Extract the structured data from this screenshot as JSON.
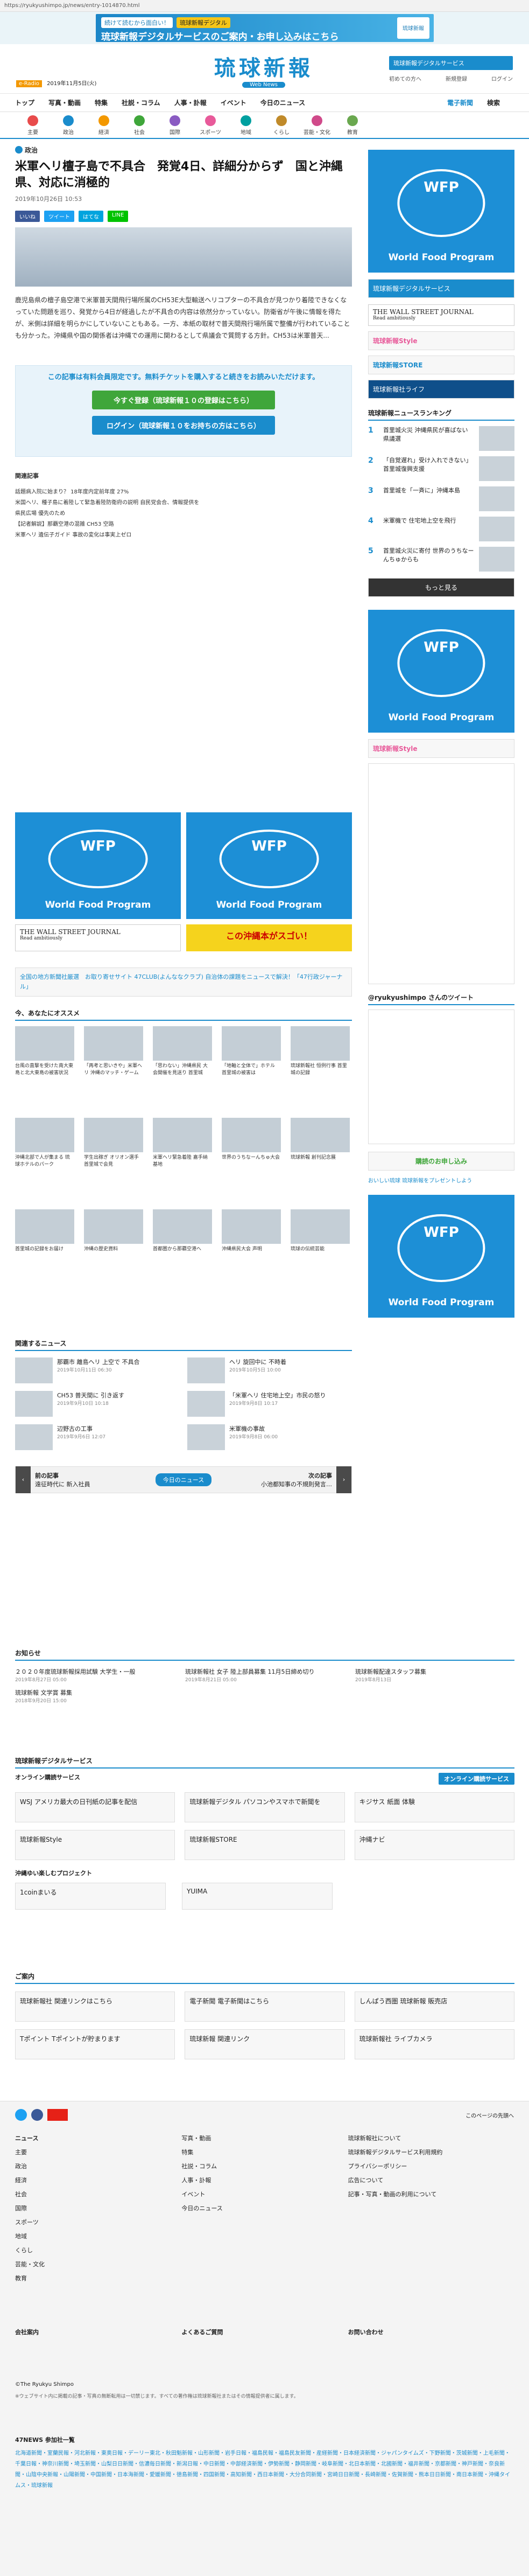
{
  "url": "https://ryukyushimpo.jp/news/entry-1014870.html",
  "top_banner": {
    "tag1": "続けて読むから面白い！",
    "tag2": "琉球新報デジタル",
    "headline": "琉球新報デジタルサービスのご案内・お申し込みはこちら",
    "badge": "琉球新報"
  },
  "header": {
    "logo": "琉球新報",
    "logo_sub": "Web News",
    "tag": "e-Radio",
    "date": "2019年11月5日(火)",
    "digital": "琉球新報デジタルサービス",
    "links": [
      "初めての方へ",
      "新規登録",
      "ログイン"
    ]
  },
  "gnav": [
    "トップ",
    "写真・動画",
    "特集",
    "社説・コラム",
    "人事・訃報",
    "イベント",
    "今日のニュース"
  ],
  "gnav_right": [
    "電子新聞",
    "検索"
  ],
  "cnav": [
    {
      "label": "主要",
      "color": "#e84b4b"
    },
    {
      "label": "政治",
      "color": "#1a8ccc"
    },
    {
      "label": "経済",
      "color": "#f39800"
    },
    {
      "label": "社会",
      "color": "#3fa63a"
    },
    {
      "label": "国際",
      "color": "#8a5bc2"
    },
    {
      "label": "スポーツ",
      "color": "#e85a9a"
    },
    {
      "label": "地域",
      "color": "#00a0a0"
    },
    {
      "label": "くらし",
      "color": "#c08a2a"
    },
    {
      "label": "芸能・文化",
      "color": "#d04a8a"
    },
    {
      "label": "教育",
      "color": "#6aa84f"
    }
  ],
  "article": {
    "category": "政治",
    "title": "米軍ヘリ檀子島で不具合　発覚4日、詳細分からず　国と沖縄県、対応に消極的",
    "date": "2019年10月26日 10:53",
    "share": [
      "いいね",
      "ツイート",
      "はてな",
      "LINE"
    ],
    "lead": "鹿児島県の檀子島空港で米軍普天間飛行場所属のCH53E大型輸送ヘリコプターの不具合が見つかり着陸できなくなっていた問題を巡り、発覚から4日が経過したが不具合の内容は依然分かっていない。防衛省が午後に情報を得たが、米側は詳細を明らかにしていないこともある。一方、本紙の取材で普天間飛行場所属で整備が行われていることも分かった。沖縄県や国の関係者は沖縄での運用に関わるとして県議会で質問する方針。CH53は米軍普天..."
  },
  "paywall": {
    "msg": "この記事は有料会員限定です。無料チケットを購入すると続きをお読みいただけます。",
    "btn1": "今すぐ登録（琉球新報１０の登録はこちら）",
    "btn2": "ログイン（琉球新報１０をお持ちの方はこちら）"
  },
  "related": {
    "heading": "関連記事",
    "items": [
      "話題病入院に始まり？ 18年度内定前年度 27%",
      "米国ヘリ、種子島に着陸して緊急着陸防衛府の説明 自民党会合、情報提供を",
      "県民広場 優先のため",
      "【記者解説】那覇空港の混雑 CH53 空路",
      "米軍ヘリ 遺伝子ガイド 事故の変化は事実上ゼロ"
    ]
  },
  "wfp": {
    "line1": "WFP",
    "line2": "World Food Program"
  },
  "wsj": {
    "title": "THE WALL STREET JOURNAL",
    "sub": "Read ambitiously"
  },
  "okinawa": "この沖縄本がスゴい！",
  "campaign": "全国の地方新聞社厳選　お取り寄せサイト 47CLUB(よんななクラブ) 自治体の課題をニュースで解決！「47行政ジャーナル」",
  "recommend": {
    "heading": "今、あなたにオススメ",
    "cards": [
      "台風の直撃を受けた南大東島と北大東島の被害状況",
      "「再考と思いきや」米軍へリ 沖縄のマッチ・ゲーム",
      "「思わない」沖縄県民 大会開催を見送り 首里城",
      "「地軸と全体で」ホテル 首里城の被害は",
      "琉球新報社 恒例行事 首里城の記録",
      "沖縄北部で人が集まる 琉球ホテルのパーク",
      "学生出稼ぎ オリオン選手 首里城で会見",
      "米軍ヘリ緊急着陸 嘉手納基地",
      "世界のうちなーんちゅ大会",
      "琉球新報 創刊記念展",
      "首里城の記録をお届け",
      "沖縄の歴史資料",
      "首都圏から那覇空港へ",
      "沖縄県民大会 声明",
      "琉球の伝統芸能"
    ]
  },
  "news_list": {
    "heading": "関連するニュース",
    "items": [
      "那覇市 離島ヘリ 上空で 不具合",
      "ヘリ 旋回中に 不時着",
      "CH53 普天間に 引き返す",
      "「米軍ヘリ 住宅地上空」市民の怒り",
      "辺野古の工事",
      "米軍機の事故"
    ],
    "dates": [
      "2019年10月11日 06:30",
      "2019年10月5日 10:00",
      "2019年9月10日 10:18",
      "2019年9月8日 10:17",
      "2019年9月6日 12:07",
      "2019年9月8日 06:00"
    ]
  },
  "pager": {
    "prev": "前の記事",
    "prev_title": "遠征時代に 新入社員",
    "today": "今日のニュース",
    "next": "次の記事",
    "next_title": "小池都知事の不規則発言…"
  },
  "sidebar": {
    "ranking": "琉球新報ニュースランキング",
    "ranks": [
      "首里城火災 沖縄県民が喜ばない 県議選",
      "「自覚遅れ」受け入れできない」 首里城復興支援",
      "首里城を「一斉に」沖縄本島",
      "米軍機で 住宅地上空を飛行",
      "首里城火災に寄付 世界のうちなーんちゅからも"
    ],
    "more": "もっと見る",
    "twitter": "@ryukyushimpo さんのツイート",
    "apply": "購読のお申し込み",
    "gift": "おいしい琉球 琉球新報をプレゼントしよう",
    "store": "琉球新報STORE",
    "life": "琉球新報社ライフ"
  },
  "notice": {
    "heading": "お知らせ",
    "items": [
      "２０２０年度琉球新報採用試験 大学生・一般",
      "琉球新報社 女子 陸上部員募集 11月5日締め切り",
      "琉球新報配達スタッフ募集",
      "琉球新報 文学賞 募集",
      "琉球新報 記事の使用について"
    ],
    "dates": [
      "2019年8月27日 05:00",
      "2019年8月21日 05:00",
      "2019年8月13日",
      "2018年9月20日 15:00"
    ]
  },
  "digital": {
    "heading": "琉球新報デジタルサービス",
    "online": "オンライン購読サービス",
    "items": [
      "WSJ アメリカ最大の日刊紙の記事を配信",
      "琉球新報デジタル パソコンやスマホで新聞を",
      "キジサス 紙面 体験",
      "琉球新報Style",
      "琉球新報STORE",
      "沖縄ナビ"
    ],
    "okinawa_sub": "沖縄ゆい楽しむプロジェクト",
    "yuima": [
      "1coinまいる",
      "YUIMA"
    ]
  },
  "guide": {
    "heading": "ご案内",
    "items": [
      "琉球新報社 関連リンクはこちら",
      "電子新聞 電子新聞はこちら",
      "しんぱう西圏 琉球新報 販売店",
      "Tポイント Tポイントが貯まります",
      "琉球新報 関連リンク",
      "琉球新報社 ライブカメラ"
    ]
  },
  "footer": {
    "cols": [
      [
        "ニュース",
        "主要",
        "政治",
        "経済",
        "社会",
        "国際",
        "スポーツ",
        "地域",
        "くらし",
        "芸能・文化",
        "教育"
      ],
      [
        "写真・動画",
        "特集",
        "社説・コラム",
        "人事・訃報",
        "イベント",
        "今日のニュース"
      ],
      [
        "琉球新報社について",
        "琉球新報デジタルサービス利用規約",
        "プライバシーポリシー",
        "広告について",
        "記事・写真・動画の利用について"
      ]
    ],
    "company": [
      "会社案内",
      "よくあるご質問",
      "お問い合わせ"
    ],
    "copyright": "©The Ryukyu Shimpo",
    "note": "※ウェブサイト内に掲載の記事・写真の無断転用は一切禁じます。すべての著作権は琉球新報社またはその情報提供者に属します。",
    "prev": "このページの先頭へ",
    "partners_h": "47NEWS 参加社一覧",
    "partners": "北海道新聞・室蘭民報・河北新報・東奥日報・デーリー東北・秋田魁新報・山形新聞・岩手日報・福島民報・福島民友新聞・産経新聞・日本経済新聞・ジャパンタイムズ・下野新聞・茨城新聞・上毛新聞・千葉日報・神奈川新聞・埼玉新聞・山梨日日新聞・信濃毎日新聞・新潟日報・中日新聞・中部経済新聞・伊勢新聞・静岡新聞・岐阜新聞・北日本新聞・北國新聞・福井新聞・京都新聞・神戸新聞・奈良新聞・山陰中央新報・山陽新聞・中国新聞・日本海新聞・愛媛新聞・徳島新聞・四国新聞・高知新聞・西日本新聞・大分合同新聞・宮崎日日新聞・長崎新聞・佐賀新聞・熊本日日新聞・南日本新聞・沖縄タイムス・琉球新報"
  }
}
